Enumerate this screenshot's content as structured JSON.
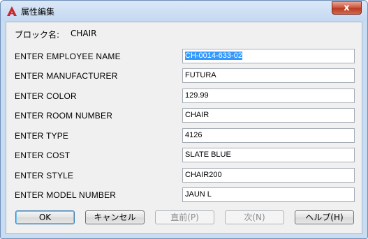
{
  "window": {
    "title": "属性編集",
    "close_glyph": "x"
  },
  "block": {
    "label": "ブロック名:",
    "name": "CHAIR"
  },
  "attributes": [
    {
      "label": "ENTER EMPLOYEE NAME",
      "value": "CH-0014-633-02"
    },
    {
      "label": "ENTER MANUFACTURER",
      "value": "FUTURA"
    },
    {
      "label": "ENTER COLOR",
      "value": "129.99"
    },
    {
      "label": "ENTER ROOM NUMBER",
      "value": "CHAIR"
    },
    {
      "label": "ENTER TYPE",
      "value": "4126"
    },
    {
      "label": "ENTER COST",
      "value": "SLATE BLUE"
    },
    {
      "label": "ENTER STYLE",
      "value": "CHAIR200"
    },
    {
      "label": "ENTER MODEL NUMBER",
      "value": "JAUN L"
    }
  ],
  "buttons": {
    "ok": "OK",
    "cancel": "キャンセル",
    "previous": "直前(P)",
    "next": "次(N)",
    "help": "ヘルプ(H)"
  },
  "colors": {
    "selection": "#3399ff",
    "app_icon": "#c8262d"
  }
}
